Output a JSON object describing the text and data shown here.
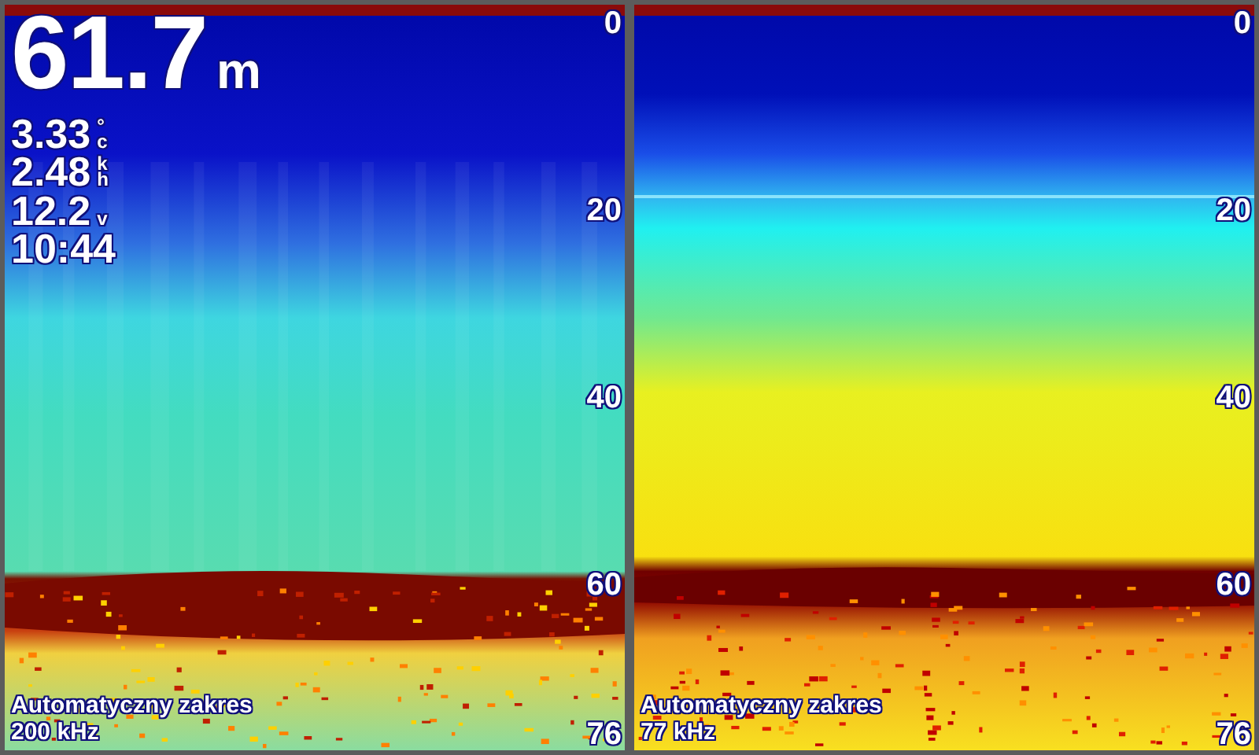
{
  "depth": {
    "value": "61.7",
    "unit": "m"
  },
  "readouts": [
    {
      "value": "3.33",
      "unit": "°c"
    },
    {
      "value": "2.48",
      "unit": "kh"
    },
    {
      "value": "12.2",
      "unit": "v"
    },
    {
      "value": "10:44"
    }
  ],
  "panels": [
    {
      "kind": "high",
      "range_mode": "Automatyczny zakres",
      "frequency": "200 kHz",
      "scale": [
        "0",
        "20",
        "40",
        "60",
        "76"
      ]
    },
    {
      "kind": "low",
      "range_mode": "Automatyczny zakres",
      "frequency": "77 kHz",
      "scale": [
        "0",
        "20",
        "40",
        "60",
        "76"
      ]
    }
  ]
}
